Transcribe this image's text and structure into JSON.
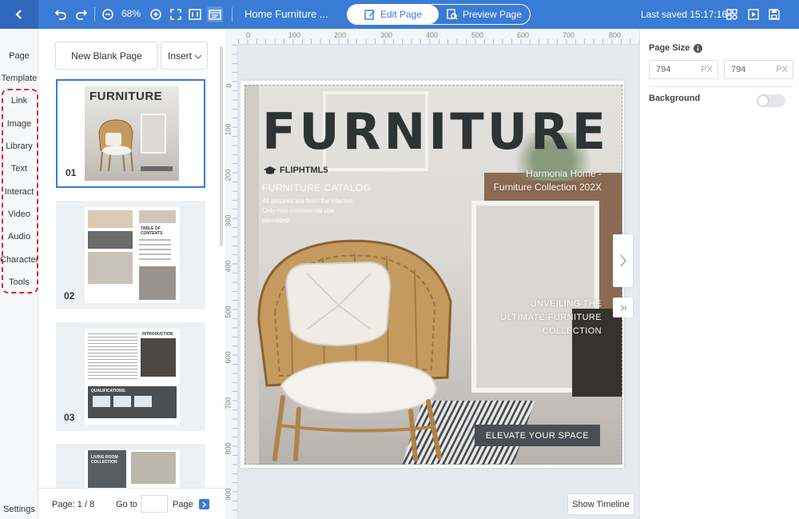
{
  "topbar": {
    "zoom": "68%",
    "doc_title": "Home Furniture ...",
    "edit_label": "Edit Page",
    "preview_label": "Preview Page",
    "saved": "Last saved 15:17:16"
  },
  "leftnav": [
    "Page",
    "Template",
    "Link",
    "Image",
    "Library",
    "Text",
    "Interact",
    "Video",
    "Audio",
    "Character",
    "Tools"
  ],
  "settings": "Settings",
  "pages": {
    "new_blank": "New Blank Page",
    "insert": "Insert",
    "thumbs": [
      "01",
      "02",
      "03"
    ],
    "mini_title": "FURNITURE",
    "mini2_heading": "TABLE OF CONTENTS",
    "mini3_heading": "INTRODUCTION",
    "mini3_qual": "QUALIFICATIONS:",
    "mini4_heading": "LIVING ROOM COLLECTION",
    "page_info": "Page: 1 / 8",
    "goto": "Go to",
    "page": "Page"
  },
  "ruler": {
    "top": [
      "0",
      "100",
      "200",
      "300",
      "400",
      "500",
      "600",
      "700",
      "800"
    ],
    "left": [
      "0",
      "100",
      "200",
      "300",
      "400",
      "500",
      "600",
      "700",
      "800",
      "900"
    ]
  },
  "cover": {
    "title": "FURNITURE",
    "brand": "FLIPHTML5",
    "catalog": "FURNITURE CATALOG",
    "disclaimer1": "All pictures are from the internet.",
    "disclaimer2": "Only non-commercial use",
    "disclaimer3": "permitted.",
    "harmonia1": "Harmonia Home -",
    "harmonia2": "Furniture Collection 202X",
    "unveil1": "UNVEILING THE",
    "unveil2": "ULTIMATE FURNITURE",
    "unveil3": "COLLECTION",
    "elevate": "ELEVATE YOUR SPACE"
  },
  "right": {
    "page_size": "Page Size",
    "width": "794",
    "height": "794",
    "unit": "PX",
    "background": "Background"
  },
  "show_timeline": "Show Timeline",
  "colors": {
    "accent": "#3a7bd5",
    "highlight": "#e0282e",
    "title_dark": "#2e3336"
  }
}
